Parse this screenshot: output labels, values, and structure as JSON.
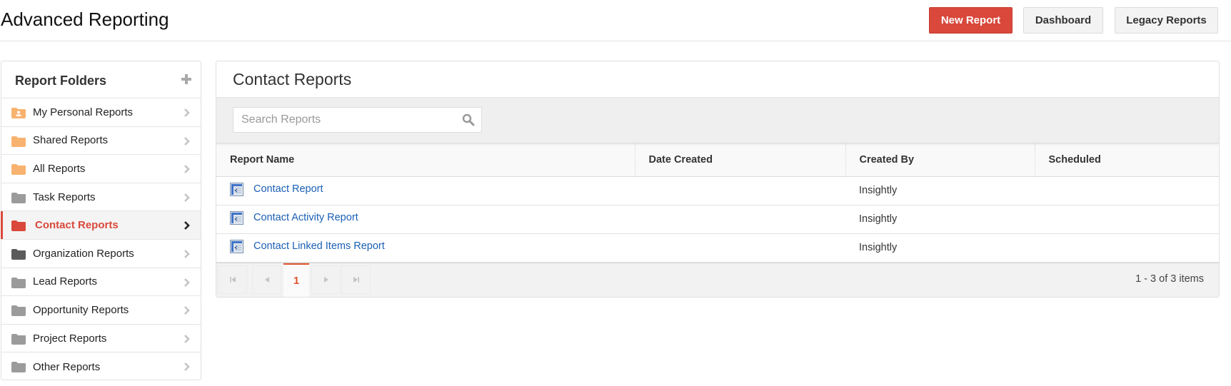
{
  "app": {
    "title": "Advanced Reporting"
  },
  "toolbar": {
    "new_report_label": "New Report",
    "dashboard_label": "Dashboard",
    "legacy_reports_label": "Legacy Reports"
  },
  "colors": {
    "accent": "#d9483b",
    "link": "#1a5fb4",
    "folder_orange": "#f8b26f",
    "folder_gray": "#9b9b9b",
    "folder_dark": "#5b5b5b"
  },
  "sidebar": {
    "title": "Report Folders",
    "add_icon": "plus-icon",
    "items": [
      {
        "label": "My Personal Reports",
        "icon": "personal-folder-icon",
        "color": "#f8b26f",
        "active": false
      },
      {
        "label": "Shared Reports",
        "icon": "folder-icon",
        "color": "#f8b26f",
        "active": false
      },
      {
        "label": "All Reports",
        "icon": "folder-icon",
        "color": "#f8b26f",
        "active": false
      },
      {
        "label": "Task Reports",
        "icon": "folder-icon",
        "color": "#9b9b9b",
        "active": false
      },
      {
        "label": "Contact Reports",
        "icon": "folder-icon",
        "color": "#d9483b",
        "active": true
      },
      {
        "label": "Organization Reports",
        "icon": "folder-icon",
        "color": "#5b5b5b",
        "active": false
      },
      {
        "label": "Lead Reports",
        "icon": "folder-icon",
        "color": "#9b9b9b",
        "active": false
      },
      {
        "label": "Opportunity Reports",
        "icon": "folder-icon",
        "color": "#9b9b9b",
        "active": false
      },
      {
        "label": "Project Reports",
        "icon": "folder-icon",
        "color": "#9b9b9b",
        "active": false
      },
      {
        "label": "Other Reports",
        "icon": "folder-icon",
        "color": "#9b9b9b",
        "active": false
      }
    ]
  },
  "main": {
    "title": "Contact Reports",
    "search": {
      "placeholder": "Search Reports",
      "value": ""
    },
    "table": {
      "columns": [
        "Report Name",
        "Date Created",
        "Created By",
        "Scheduled"
      ],
      "rows": [
        {
          "name": "Contact Report",
          "date_created": "",
          "created_by": "Insightly",
          "scheduled": ""
        },
        {
          "name": "Contact Activity Report",
          "date_created": "",
          "created_by": "Insightly",
          "scheduled": ""
        },
        {
          "name": "Contact Linked Items Report",
          "date_created": "",
          "created_by": "Insightly",
          "scheduled": ""
        }
      ]
    },
    "pager": {
      "current_page": "1",
      "info": "1 - 3 of 3 items"
    }
  }
}
